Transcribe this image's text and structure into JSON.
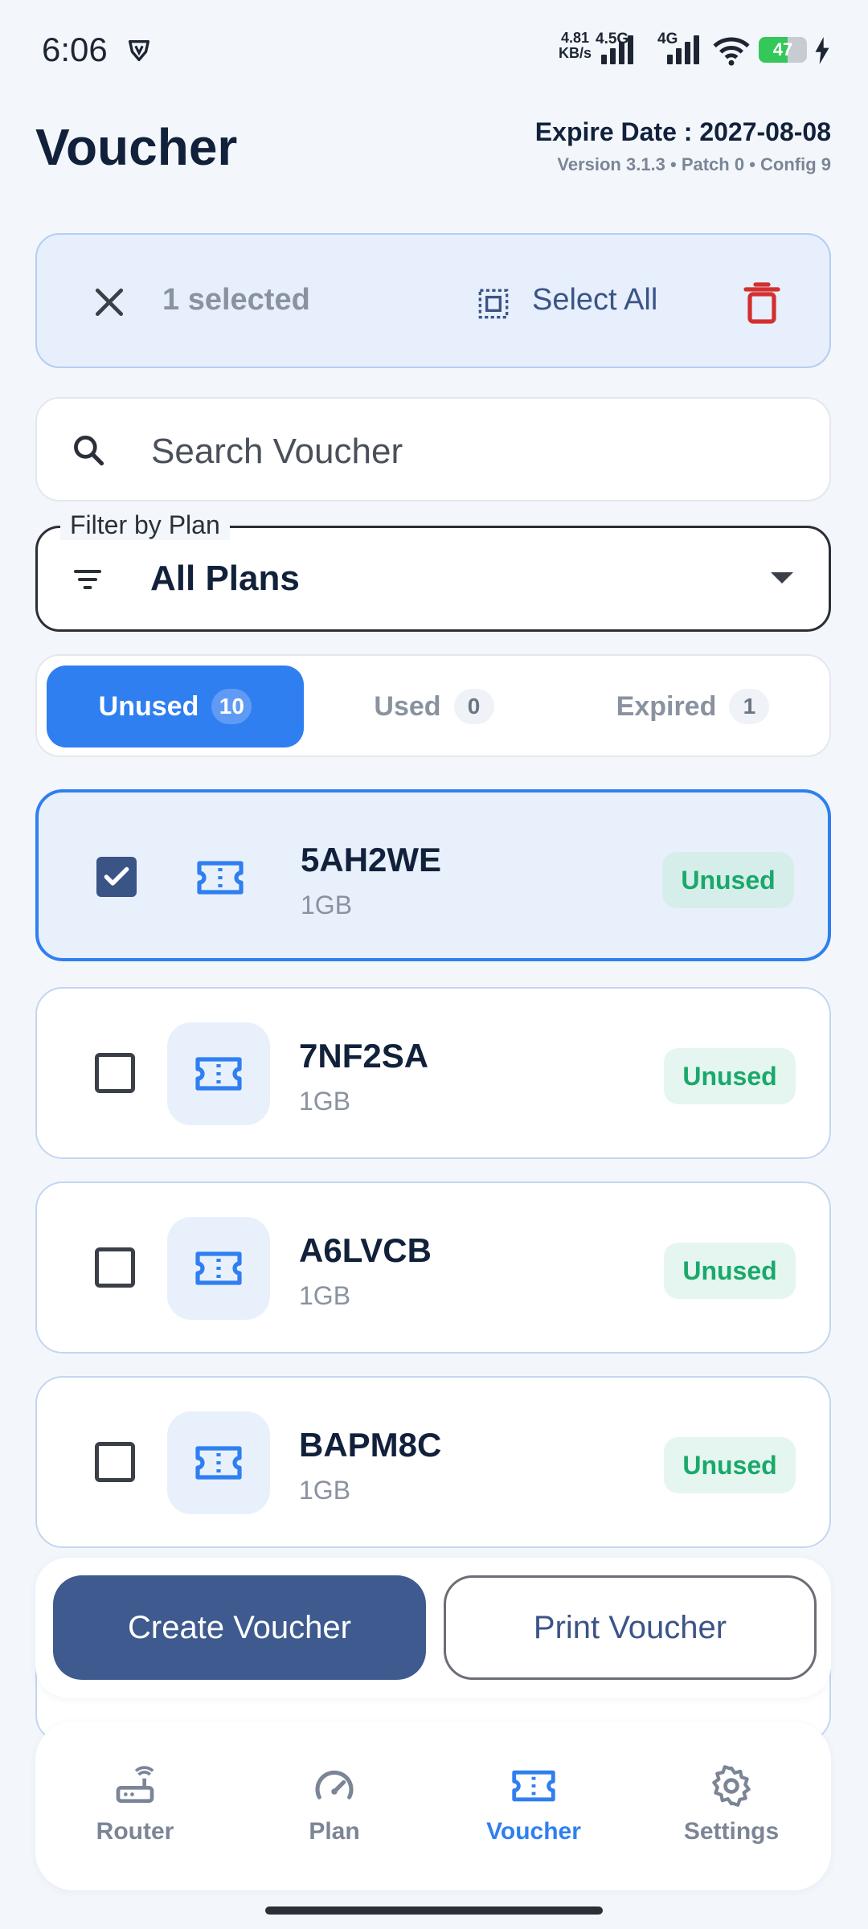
{
  "status_bar": {
    "time": "6:06",
    "net_speed_value": "4.81",
    "net_speed_unit": "KB/s",
    "net_type_1": "4.5G",
    "net_type_2": "4G",
    "battery": "47",
    "icons": [
      "vpn-icon",
      "signal-icon",
      "wifi-icon",
      "battery-icon",
      "charging-icon"
    ]
  },
  "header": {
    "title": "Voucher",
    "expire": "Expire Date : 2027-08-08",
    "version": "Version 3.1.3 • Patch 0 • Config 9"
  },
  "selection_bar": {
    "count_label": "1 selected",
    "select_all_label": "Select All",
    "delete_color": "#d32f2f"
  },
  "search": {
    "placeholder": "Search Voucher",
    "value": ""
  },
  "filter": {
    "label": "Filter by Plan",
    "value": "All Plans"
  },
  "tabs": [
    {
      "label": "Unused",
      "count": "10",
      "active": true
    },
    {
      "label": "Used",
      "count": "0",
      "active": false
    },
    {
      "label": "Expired",
      "count": "1",
      "active": false
    }
  ],
  "vouchers": [
    {
      "code": "5AH2WE",
      "plan": "1GB",
      "status": "Unused",
      "selected": true
    },
    {
      "code": "7NF2SA",
      "plan": "1GB",
      "status": "Unused",
      "selected": false
    },
    {
      "code": "A6LVCB",
      "plan": "1GB",
      "status": "Unused",
      "selected": false
    },
    {
      "code": "BAPM8C",
      "plan": "1GB",
      "status": "Unused",
      "selected": false
    }
  ],
  "actions": {
    "create_label": "Create Voucher",
    "print_label": "Print Voucher"
  },
  "nav": [
    {
      "label": "Router",
      "icon": "router-icon",
      "active": false
    },
    {
      "label": "Plan",
      "icon": "gauge-icon",
      "active": false
    },
    {
      "label": "Voucher",
      "icon": "ticket-icon",
      "active": true
    },
    {
      "label": "Settings",
      "icon": "gear-icon",
      "active": false
    }
  ],
  "colors": {
    "accent": "#2f7ff0",
    "primary_button": "#3e5a8f",
    "unused_status": "#1aa86b",
    "background": "#f3f7fc"
  }
}
